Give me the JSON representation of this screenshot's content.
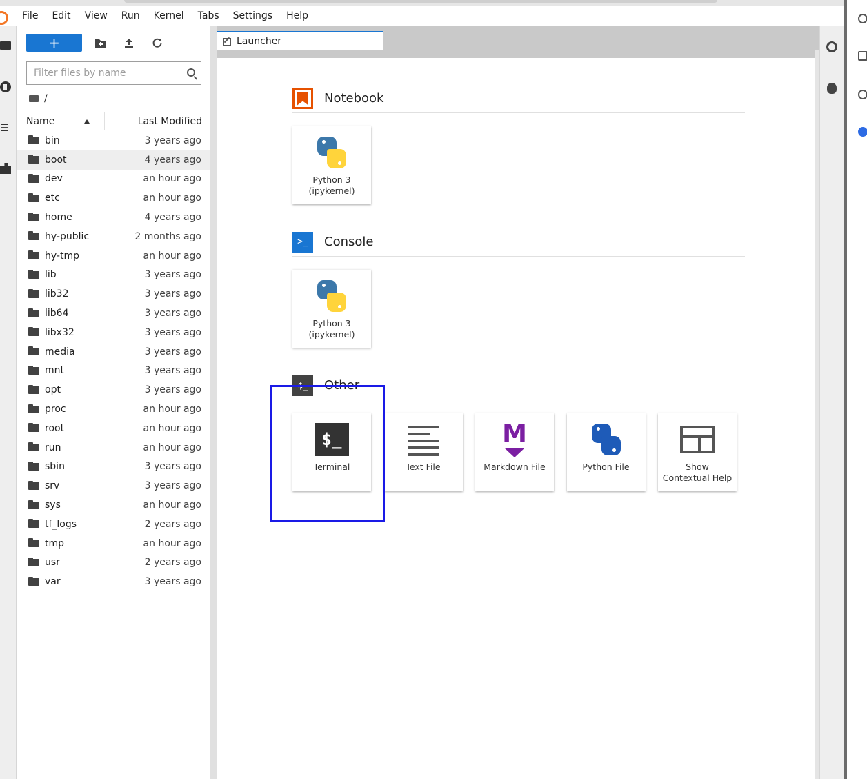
{
  "menu": [
    "File",
    "Edit",
    "View",
    "Run",
    "Kernel",
    "Tabs",
    "Settings",
    "Help"
  ],
  "toolbar": {
    "new_label": "+",
    "icons": [
      "new-folder-icon",
      "upload-icon",
      "refresh-icon"
    ]
  },
  "filter": {
    "placeholder": "Filter files by name"
  },
  "breadcrumb": "/",
  "listing": {
    "name_header": "Name",
    "modified_header": "Last Modified",
    "selected": "boot",
    "rows": [
      {
        "name": "bin",
        "modified": "3 years ago"
      },
      {
        "name": "boot",
        "modified": "4 years ago"
      },
      {
        "name": "dev",
        "modified": "an hour ago"
      },
      {
        "name": "etc",
        "modified": "an hour ago"
      },
      {
        "name": "home",
        "modified": "4 years ago"
      },
      {
        "name": "hy-public",
        "modified": "2 months ago"
      },
      {
        "name": "hy-tmp",
        "modified": "an hour ago"
      },
      {
        "name": "lib",
        "modified": "3 years ago"
      },
      {
        "name": "lib32",
        "modified": "3 years ago"
      },
      {
        "name": "lib64",
        "modified": "3 years ago"
      },
      {
        "name": "libx32",
        "modified": "3 years ago"
      },
      {
        "name": "media",
        "modified": "3 years ago"
      },
      {
        "name": "mnt",
        "modified": "3 years ago"
      },
      {
        "name": "opt",
        "modified": "3 years ago"
      },
      {
        "name": "proc",
        "modified": "an hour ago"
      },
      {
        "name": "root",
        "modified": "an hour ago"
      },
      {
        "name": "run",
        "modified": "an hour ago"
      },
      {
        "name": "sbin",
        "modified": "3 years ago"
      },
      {
        "name": "srv",
        "modified": "3 years ago"
      },
      {
        "name": "sys",
        "modified": "an hour ago"
      },
      {
        "name": "tf_logs",
        "modified": "2 years ago"
      },
      {
        "name": "tmp",
        "modified": "an hour ago"
      },
      {
        "name": "usr",
        "modified": "2 years ago"
      },
      {
        "name": "var",
        "modified": "3 years ago"
      }
    ]
  },
  "tab": {
    "label": "Launcher"
  },
  "launcher": {
    "notebook": {
      "title": "Notebook",
      "cards": [
        {
          "label": "Python 3 (ipykernel)",
          "icon": "python-icon"
        }
      ]
    },
    "console": {
      "title": "Console",
      "icon_text": ">_",
      "cards": [
        {
          "label": "Python 3 (ipykernel)",
          "icon": "python-icon"
        }
      ]
    },
    "other": {
      "title": "Other",
      "icon_text": "$_",
      "cards": [
        {
          "label": "Terminal",
          "icon": "terminal-icon",
          "icon_text": "$_"
        },
        {
          "label": "Text File",
          "icon": "text-file-icon"
        },
        {
          "label": "Markdown File",
          "icon": "markdown-icon",
          "icon_text": "M"
        },
        {
          "label": "Python File",
          "icon": "python-file-icon"
        },
        {
          "label": "Show Contextual Help",
          "icon": "contextual-help-icon"
        }
      ]
    }
  },
  "colors": {
    "accent": "#1976d2",
    "notebook": "#e65100",
    "markdown": "#7b1fa2",
    "highlight_box": "#1a1ae6"
  }
}
